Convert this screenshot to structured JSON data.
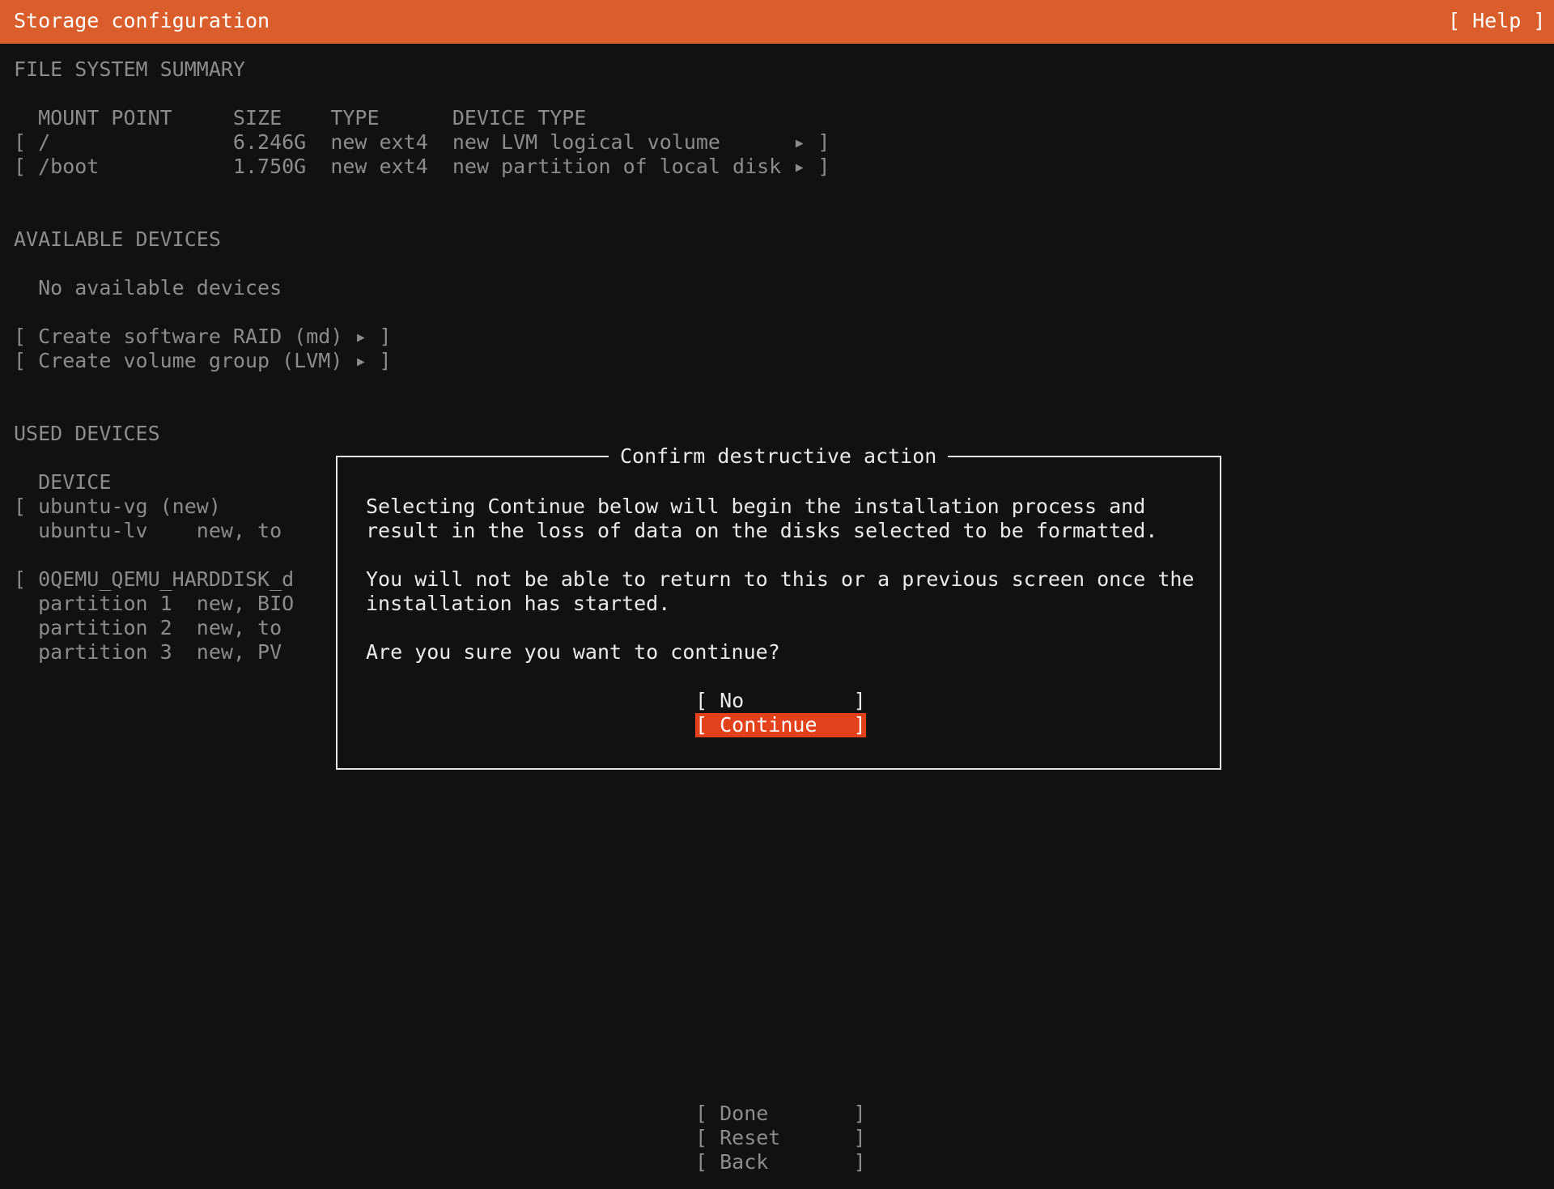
{
  "header": {
    "title": "Storage configuration",
    "help_label": "[ Help ]"
  },
  "fs_summary": {
    "heading": "FILE SYSTEM SUMMARY",
    "col_header": "  MOUNT POINT     SIZE    TYPE      DEVICE TYPE",
    "rows": [
      "[ /               6.246G  new ext4  new LVM logical volume      ▸ ]",
      "[ /boot           1.750G  new ext4  new partition of local disk ▸ ]"
    ]
  },
  "available": {
    "heading": "AVAILABLE DEVICES",
    "empty_text": "  No available devices",
    "actions": [
      "[ Create software RAID (md) ▸ ]",
      "[ Create volume group (LVM) ▸ ]"
    ]
  },
  "used": {
    "heading": "USED DEVICES",
    "col_header": "  DEVICE",
    "rows": [
      "[ ubuntu-vg (new)",
      "  ubuntu-lv    new, to",
      "",
      "[ 0QEMU_QEMU_HARDDISK_d",
      "  partition 1  new, BIO",
      "  partition 2  new, to",
      "  partition 3  new, PV"
    ]
  },
  "dialog": {
    "title": "Confirm destructive action",
    "lines": [
      "Selecting Continue below will begin the installation process and",
      "result in the loss of data on the disks selected to be formatted.",
      "",
      "You will not be able to return to this or a previous screen once the",
      "installation has started.",
      "",
      "Are you sure you want to continue?"
    ],
    "no_label": "[ No         ]",
    "continue_label": "[ Continue   ]"
  },
  "footer": {
    "done_label": "[ Done       ]",
    "reset_label": "[ Reset      ]",
    "back_label": "[ Back       ]"
  },
  "colors": {
    "header_bg": "#d95e2b",
    "selected_button_bg": "#e2411b",
    "background": "#111111"
  }
}
